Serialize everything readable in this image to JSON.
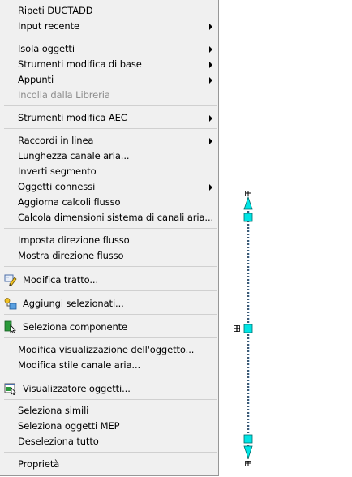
{
  "menu": {
    "repeat": "Ripeti DUCTADD",
    "recent_input": "Input recente",
    "isolate": "Isola oggetti",
    "basic_tools": "Strumenti modifica di base",
    "notes": "Appunti",
    "paste_library": "Incolla dalla Libreria",
    "aec_tools": "Strumenti modifica AEC",
    "inline_fittings": "Raccordi in linea",
    "duct_length": "Lunghezza canale aria...",
    "reverse_segment": "Inverti segmento",
    "connected_objects": "Oggetti connessi",
    "update_flow": "Aggiorna calcoli flusso",
    "calc_sizes": "Calcola dimensioni sistema di canali aria...",
    "set_flow_dir": "Imposta direzione flusso",
    "show_flow_dir": "Mostra direzione flusso",
    "edit_run": "Modifica tratto...",
    "add_selected": "Aggiungi selezionati...",
    "select_component": "Seleziona componente",
    "edit_display": "Modifica visualizzazione dell'oggetto...",
    "edit_duct_style": "Modifica stile canale aria...",
    "object_viewer": "Visualizzatore oggetti...",
    "select_similar": "Seleziona simili",
    "select_mep": "Seleziona oggetti MEP",
    "deselect_all": "Deseleziona tutto",
    "properties": "Proprietà"
  },
  "colors": {
    "grip": "#00e5e5",
    "accent_green": "#2a9a3a",
    "accent_yellow": "#f0c020"
  },
  "icons": {
    "edit_run": "pencil-icon",
    "add_selected": "add-objects-icon",
    "select_component": "select-component-icon",
    "object_viewer": "object-viewer-icon"
  }
}
